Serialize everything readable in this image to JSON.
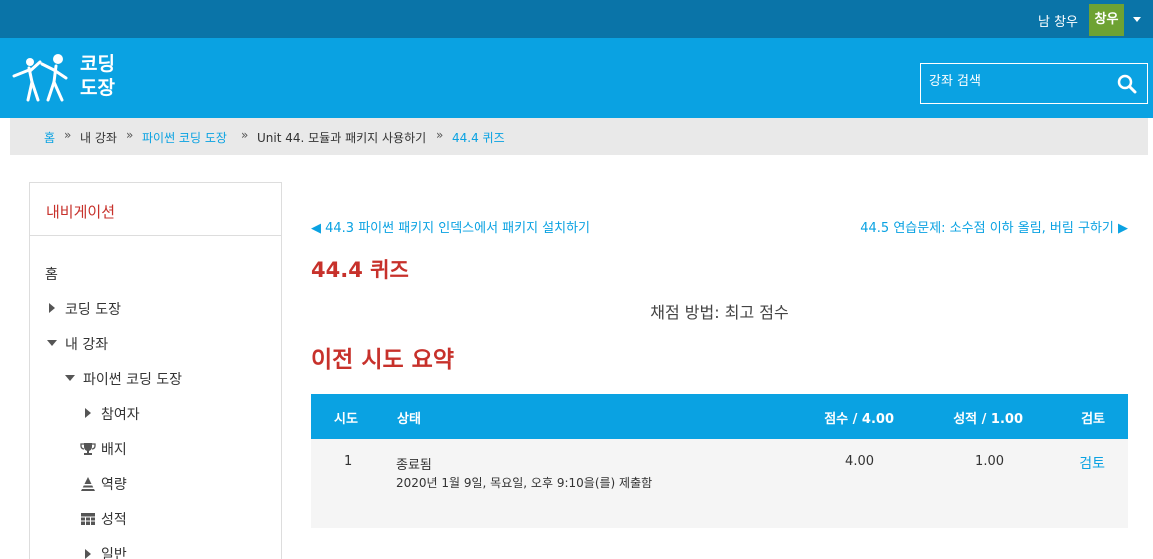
{
  "user": {
    "name": "남 창우",
    "avatar_text": "창우"
  },
  "brand": {
    "line1": "코딩",
    "line2": "도장",
    "accent": "#0aa2e2"
  },
  "search": {
    "placeholder": "강좌 검색"
  },
  "breadcrumb": [
    {
      "label": "홈",
      "link": true
    },
    {
      "label": "내 강좌",
      "link": false
    },
    {
      "label": "파이썬 코딩 도장",
      "link": true
    },
    {
      "label": "Unit 44. 모듈과 패키지 사용하기",
      "link": false
    },
    {
      "label": "44.4 퀴즈",
      "link": true
    }
  ],
  "breadcrumb_separator": "»",
  "sidebar": {
    "title": "내비게이션",
    "items": [
      {
        "label": "홈",
        "icon": "none"
      },
      {
        "label": "코딩 도장",
        "icon": "triangle-right"
      },
      {
        "label": "내 강좌",
        "icon": "triangle-down"
      },
      {
        "label": "파이썬 코딩 도장",
        "icon": "triangle-down"
      },
      {
        "label": "참여자",
        "icon": "triangle-right"
      },
      {
        "label": "배지",
        "icon": "trophy-icon"
      },
      {
        "label": "역량",
        "icon": "competency-icon"
      },
      {
        "label": "성적",
        "icon": "grades-table-icon"
      },
      {
        "label": "일반",
        "icon": "triangle-right"
      }
    ]
  },
  "main": {
    "prev_link": "◀ 44.3 파이썬 패키지 인덱스에서 패키지 설치하기",
    "next_link": "44.5 연습문제: 소수점 이하 올림, 버림 구하기 ▶",
    "title": "44.4 퀴즈",
    "grading_method": "채점 방법: 최고 점수",
    "summary_title": "이전 시도 요약",
    "table": {
      "headers": [
        "시도",
        "상태",
        "점수 / 4.00",
        "성적 / 1.00",
        "검토"
      ],
      "rows": [
        {
          "attempt": "1",
          "state": "종료됨",
          "submitted": "2020년 1월 9일, 목요일, 오후 9:10을(를) 제출함",
          "score": "4.00",
          "grade": "1.00",
          "review": "검토"
        }
      ]
    }
  }
}
